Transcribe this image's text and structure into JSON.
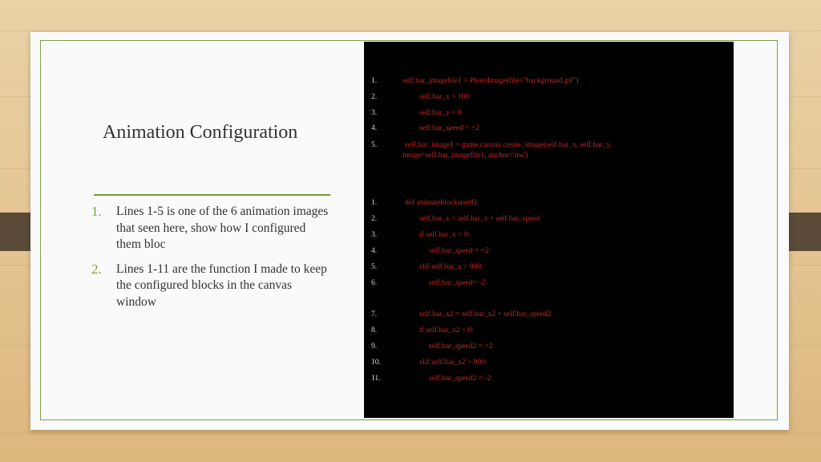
{
  "slide": {
    "title": "Animation Configuration",
    "bullets": [
      {
        "num": "1.",
        "text": "Lines 1-5 is one of the 6 animation images that seen here, show how I configured them bloc"
      },
      {
        "num": "2.",
        "text": "Lines 1-11 are the function I made to keep the configured blocks in the canvas window"
      }
    ]
  },
  "code": {
    "block1": [
      {
        "n": "1.",
        "code": "self.bar_imagefile1 = PhotoImage(file=\"background.gif\")"
      },
      {
        "n": "2.",
        "code": "self.bar_x = 100"
      },
      {
        "n": "3.",
        "code": "self.bar_y = 0"
      },
      {
        "n": "4.",
        "code": "self.bar_speed = +2"
      },
      {
        "n": "5.",
        "code": "self.bar_image1 = game.canvas.create_image(self.bar_x, self.bar_y,"
      },
      {
        "n": "",
        "code": "image=self.bar_imagefile1, anchor='nw')"
      }
    ],
    "block2": [
      {
        "n": "1.",
        "code": "def animateblocks(self):"
      },
      {
        "n": "2.",
        "code": "self.bar_x = self.bar_x + self.bar_speed"
      },
      {
        "n": "3.",
        "code": "if self.bar_x < 0:"
      },
      {
        "n": "4.",
        "code": "self.bar_speed = +2"
      },
      {
        "n": "5.",
        "code": "elif self.bar_x > 900:"
      },
      {
        "n": "6.",
        "code": "self.bar_speed= -2"
      },
      {
        "n": "7.",
        "code": "self.bar_x2 = self.bar_x2 + self.bar_speed2"
      },
      {
        "n": "8.",
        "code": "if self.bar_x2 < 0:"
      },
      {
        "n": "9.",
        "code": "self.bar_speed2 = +2"
      },
      {
        "n": "10.",
        "code": "elif self.bar_x2 > 900:"
      },
      {
        "n": "11.",
        "code": "self.bar_speed2 = -2"
      }
    ]
  },
  "colors": {
    "accent": "#7aa33c",
    "code_text": "#c62828",
    "code_bg": "#000000"
  }
}
